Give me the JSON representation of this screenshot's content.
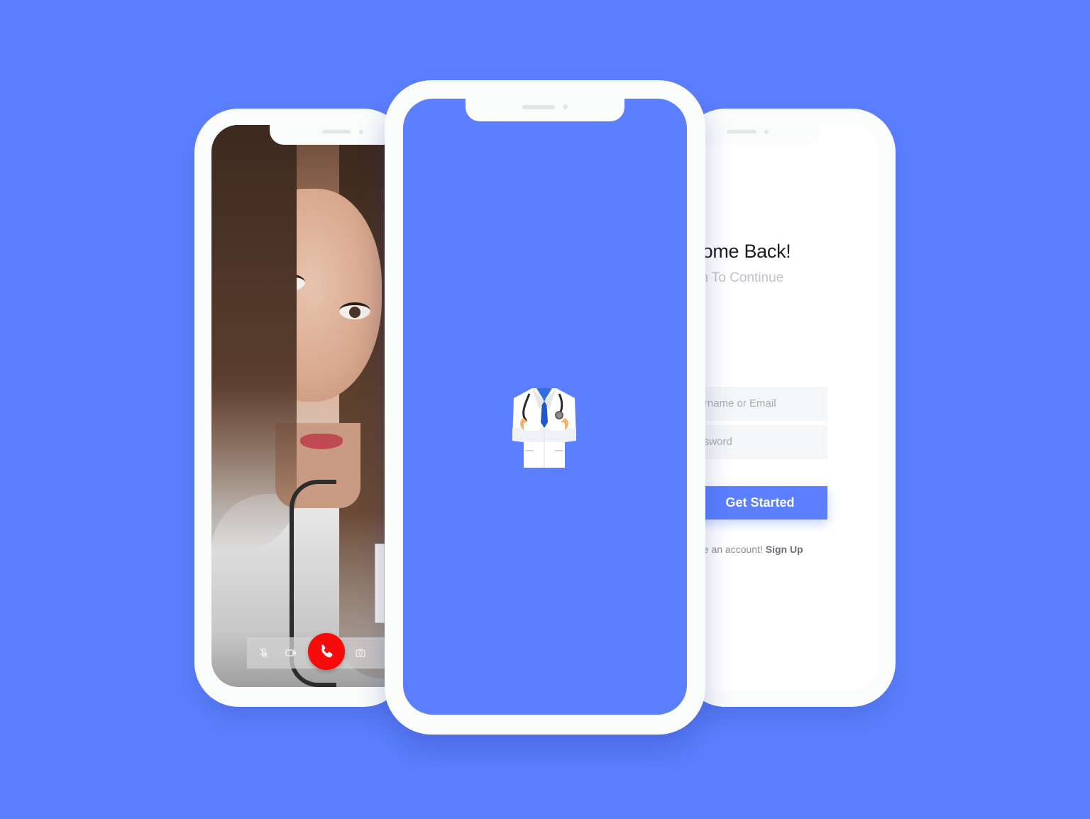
{
  "background_color": "#5b7ffe",
  "accent_color": "#5b7ffe",
  "video_call": {
    "controls": [
      {
        "name": "mute",
        "icon": "mic-off-icon"
      },
      {
        "name": "video",
        "icon": "video-camera-icon"
      },
      {
        "name": "end-call",
        "icon": "phone-icon",
        "color": "#f60a0a"
      },
      {
        "name": "switch-camera",
        "icon": "camera-icon"
      }
    ]
  },
  "splash": {
    "logo_icon": "doctor-coat-icon"
  },
  "login": {
    "title": "elcome Back!",
    "subtitle": "ogin To Continue",
    "username_placeholder": "sername or Email",
    "password_placeholder": "assword",
    "button_label": "Get Started",
    "signup_prompt": "ave an account!",
    "signup_link": "Sign Up"
  }
}
